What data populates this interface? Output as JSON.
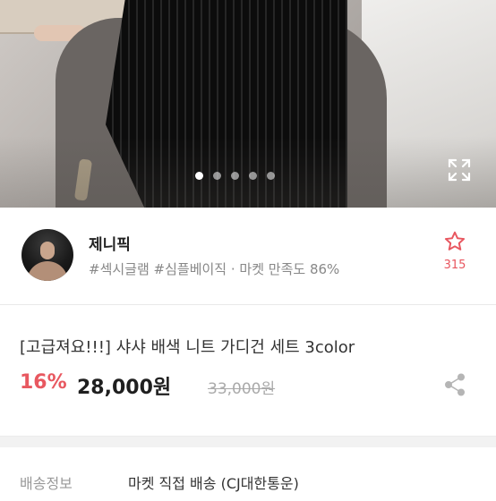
{
  "gallery": {
    "dot_count": 5,
    "active_index": 0,
    "expand_icon": "expand-icon"
  },
  "seller": {
    "name": "제니픽",
    "tags": "#섹시글램 #심플베이직 · 마켓 만족도 86%",
    "like_icon": "star-icon",
    "like_count": "315",
    "accent_color": "#e8565f"
  },
  "product": {
    "title": "[고급져요!!!] 샤샤 배색 니트 가디건 세트 3color",
    "discount": "16%",
    "price": "28,000원",
    "original_price": "33,000원",
    "share_icon": "share-icon"
  },
  "shipping": {
    "label": "배송정보",
    "value": "마켓 직접 배송 (CJ대한통운)"
  }
}
